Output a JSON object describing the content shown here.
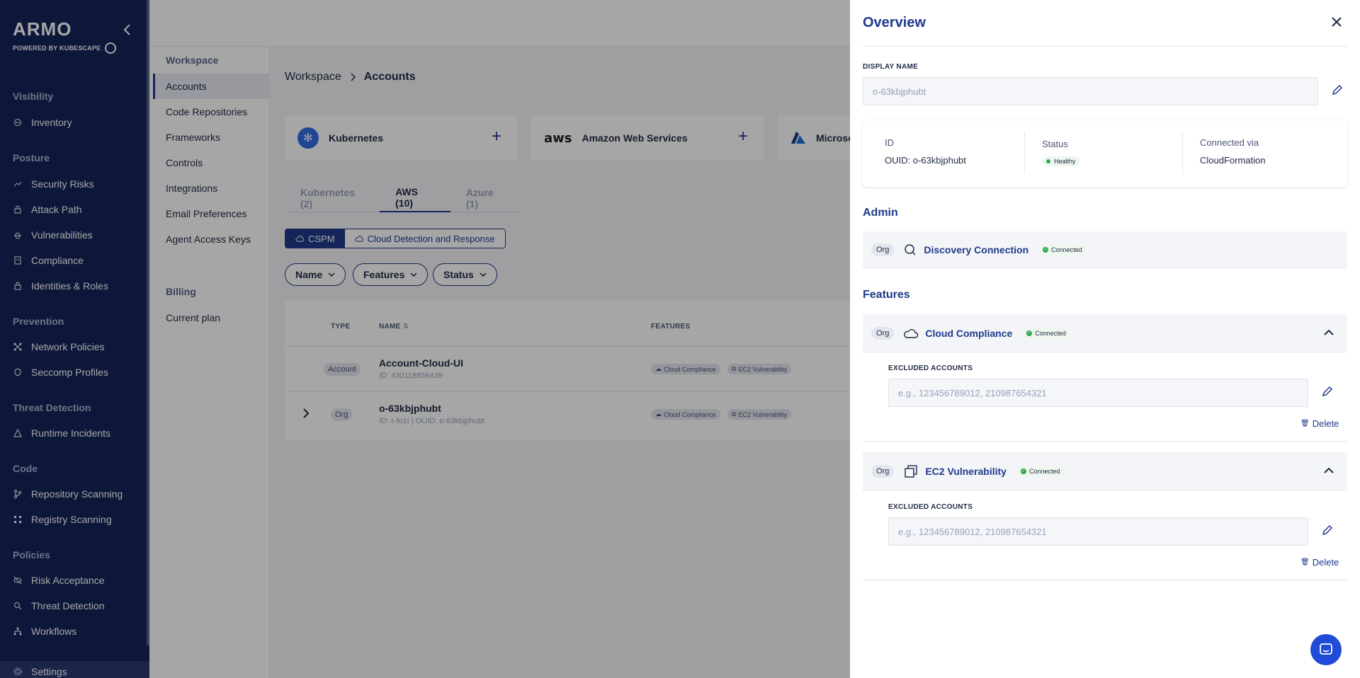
{
  "brand": {
    "name": "ARMO",
    "powered_by": "POWERED BY KUBESCAPE"
  },
  "sidebar": {
    "sections": [
      {
        "title": "Visibility",
        "items": [
          {
            "label": "Inventory",
            "icon": "inventory-icon"
          }
        ]
      },
      {
        "title": "Posture",
        "items": [
          {
            "label": "Security Risks",
            "icon": "trend-icon"
          },
          {
            "label": "Attack Path",
            "icon": "lock-icon"
          },
          {
            "label": "Vulnerabilities",
            "icon": "bug-icon"
          },
          {
            "label": "Compliance",
            "icon": "document-icon"
          },
          {
            "label": "Identities & Roles",
            "icon": "lock-icon"
          }
        ]
      },
      {
        "title": "Prevention",
        "items": [
          {
            "label": "Network Policies",
            "icon": "network-icon"
          },
          {
            "label": "Seccomp Profiles",
            "icon": "shield-icon"
          }
        ]
      },
      {
        "title": "Threat Detection",
        "items": [
          {
            "label": "Runtime Incidents",
            "icon": "warning-icon"
          }
        ]
      },
      {
        "title": "Code",
        "items": [
          {
            "label": "Repository Scanning",
            "icon": "branch-icon"
          },
          {
            "label": "Registry Scanning",
            "icon": "grid-icon"
          }
        ]
      },
      {
        "title": "Policies",
        "items": [
          {
            "label": "Risk Acceptance",
            "icon": "eye-off-icon"
          },
          {
            "label": "Threat Detection",
            "icon": "search-icon"
          },
          {
            "label": "Workflows",
            "icon": "workflow-icon"
          }
        ]
      }
    ],
    "settings_label": "Settings"
  },
  "subnav": {
    "workspace_heading": "Workspace",
    "items": [
      "Accounts",
      "Code Repositories",
      "Frameworks",
      "Controls",
      "Integrations",
      "Email Preferences",
      "Agent Access Keys"
    ],
    "billing_heading": "Billing",
    "billing_items": [
      "Current plan"
    ]
  },
  "breadcrumb": {
    "parent": "Workspace",
    "current": "Accounts"
  },
  "providers": [
    {
      "label": "Kubernetes",
      "icon": "kubernetes-icon"
    },
    {
      "label": "Amazon Web Services",
      "icon": "aws-icon"
    },
    {
      "label": "Microso",
      "icon": "azure-icon"
    }
  ],
  "tabs": [
    "Kubernetes (2)",
    "AWS (10)",
    "Azure (1)"
  ],
  "segments": [
    "CSPM",
    "Cloud Detection and Response"
  ],
  "filters": [
    "Name",
    "Features",
    "Status"
  ],
  "table": {
    "headers": {
      "type": "TYPE",
      "name": "NAME",
      "features": "FEATURES"
    },
    "rows": [
      {
        "type": "Account",
        "name": "Account-Cloud-UI",
        "id": "ID: 430118856439",
        "features": [
          "Cloud Compliance",
          "EC2 Vulnerability"
        ]
      },
      {
        "type": "Org",
        "name": "o-63kbjphubt",
        "id": "ID: r-fo1t | OUID: o-63kbjphubt",
        "features": [
          "Cloud Compliance",
          "EC2 Vulnerability"
        ]
      }
    ]
  },
  "drawer": {
    "title": "Overview",
    "display_name_label": "DISPLAY NAME",
    "display_name_value": "o-63kbjphubt",
    "info": {
      "id_label": "ID",
      "id_value": "OUID: o-63kbjphubt",
      "status_label": "Status",
      "status_value": "Healthy",
      "connected_via_label": "Connected via",
      "connected_via_value": "CloudFormation"
    },
    "admin_title": "Admin",
    "admin": {
      "scope": "Org",
      "name": "Discovery Connection",
      "status": "Connected"
    },
    "features_title": "Features",
    "features": [
      {
        "scope": "Org",
        "name": "Cloud Compliance",
        "status": "Connected",
        "excluded_label": "EXCLUDED ACCOUNTS",
        "excluded_placeholder": "e.g., 123456789012, 210987654321",
        "delete_label": "Delete"
      },
      {
        "scope": "Org",
        "name": "EC2 Vulnerability",
        "status": "Connected",
        "excluded_label": "EXCLUDED ACCOUNTS",
        "excluded_placeholder": "e.g., 123456789012, 210987654321",
        "delete_label": "Delete"
      }
    ]
  },
  "colors": {
    "nav_bg": "#15245a",
    "accent": "#1f3a8a",
    "connected": "#2fa84f",
    "chat": "#1f4bd8"
  }
}
